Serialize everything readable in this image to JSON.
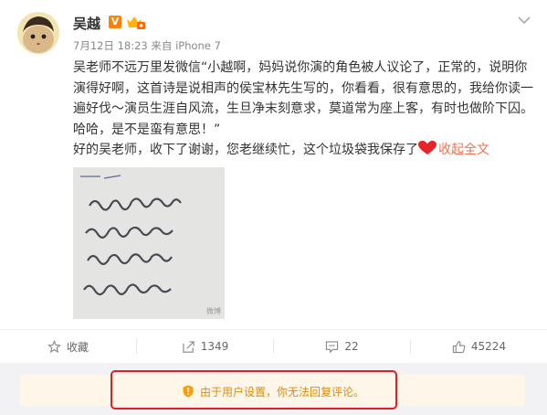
{
  "user": {
    "name": "吴越",
    "verified_badge": "V",
    "time": "7月12日 18:23",
    "source_prefix": "来自",
    "source": "iPhone 7"
  },
  "post": {
    "quote": "吴老师不远万里发微信“小越啊，妈妈说你演的角色被人议论了，正常的，说明你演得好啊，这首诗是说相声的侯宝林先生写的，你看看，很有意思的，我给你读一遍好伐～演员生涯自风流，生旦净末刻意求，莫道常为座上客，有时也做阶下囚。哈哈，是不是蛮有意思！”",
    "reply": "好的吴老师，收下了谢谢，您老继续忙，这个垃圾袋我保存了",
    "collapse_label": "收起全文"
  },
  "photo": {
    "watermark": "微博"
  },
  "actions": {
    "collect": "收藏",
    "repost_count": "1349",
    "comment_count": "22",
    "like_count": "45224"
  },
  "notice": {
    "text": "由于用户设置，你无法回复评论。"
  },
  "colors": {
    "accent_orange": "#ff8200",
    "link": "#eb7350",
    "notice_text": "#e68a00",
    "highlight_frame": "#e02020"
  },
  "icons": [
    "avatar",
    "verified-badge-icon",
    "vip-icon",
    "chevron-down-icon",
    "heart-icon",
    "star-icon",
    "repost-icon",
    "comment-icon",
    "like-icon",
    "warning-icon"
  ]
}
